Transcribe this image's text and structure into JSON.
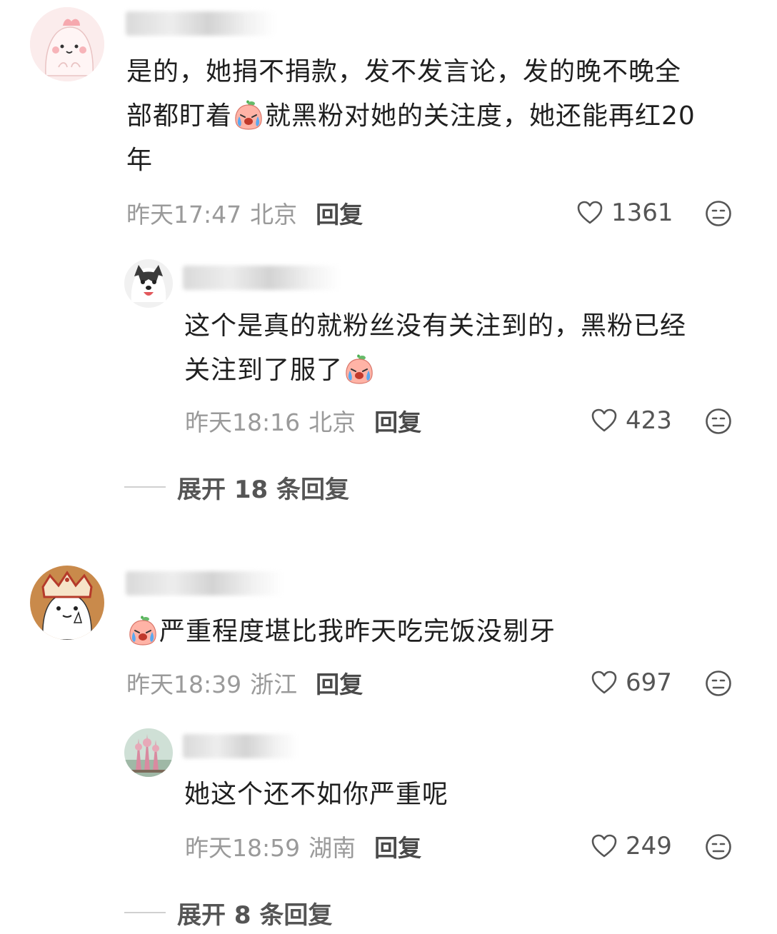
{
  "comments": [
    {
      "text_parts": [
        "是的，她捐不捐款，发不发言论，发的晚不晚全",
        "部都盯着",
        "就黑粉对她的关注度，她还能再红20",
        "年"
      ],
      "time": "昨天17:47",
      "location": "北京",
      "reply_label": "回复",
      "likes": "1361",
      "replies": [
        {
          "text_parts": [
            "这个是真的就粉丝没有关注到的，黑粉已经",
            "关注到了服了"
          ],
          "time": "昨天18:16",
          "location": "北京",
          "reply_label": "回复",
          "likes": "423"
        }
      ],
      "expand_label": "展开 18 条回复"
    },
    {
      "text_parts": [
        "严重程度堪比我昨天吃完饭没剔牙"
      ],
      "time": "昨天18:39",
      "location": "浙江",
      "reply_label": "回复",
      "likes": "697",
      "replies": [
        {
          "text_parts": [
            "她这个还不如你严重呢"
          ],
          "time": "昨天18:59",
          "location": "湖南",
          "reply_label": "回复",
          "likes": "249"
        }
      ],
      "expand_label": "展开 8 条回复"
    }
  ],
  "icons": {
    "like": "heart-outline-icon",
    "dislike": "meh-face-icon",
    "emoji": "crying-peach-emoji"
  },
  "colors": {
    "meta": "#9a9a9a",
    "text": "#1f1f1f",
    "reply": "#4a4a4a"
  }
}
